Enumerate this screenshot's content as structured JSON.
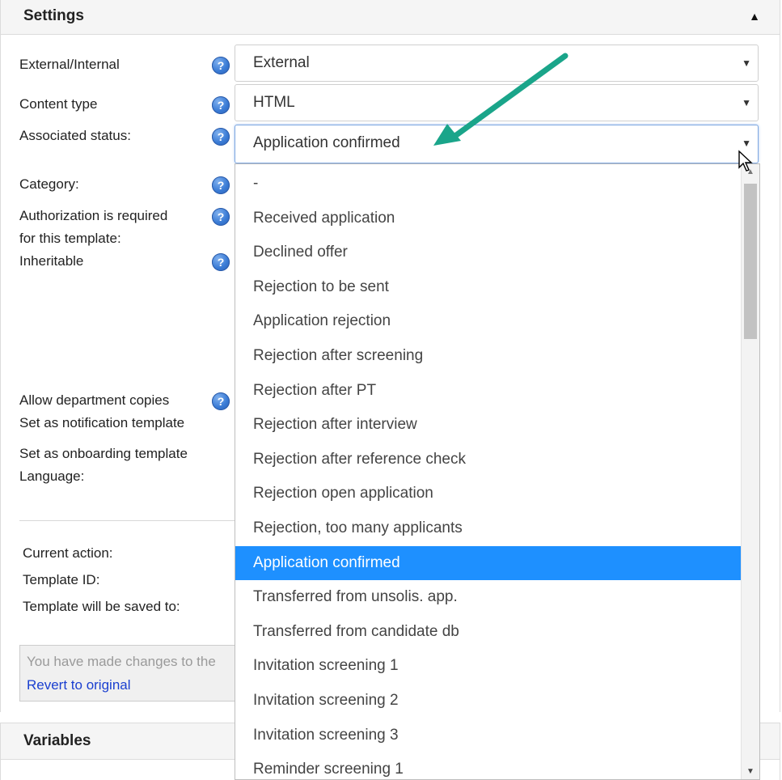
{
  "settings": {
    "title": "Settings",
    "collapse_icon": "caret-up-icon",
    "help_glyph": "?",
    "fields": {
      "external_internal": {
        "label": "External/Internal",
        "value": "External"
      },
      "content_type": {
        "label": "Content type",
        "value": "HTML"
      },
      "associated_status": {
        "label": "Associated status:",
        "value": "Application confirmed"
      },
      "category": {
        "label": "Category:"
      },
      "authorization": {
        "label_line1": "Authorization is required",
        "label_line2": "for this template:"
      },
      "inheritable": {
        "label": "Inheritable"
      },
      "allow_department_copies": {
        "label": "Allow department copies"
      },
      "notification_template": {
        "label": "Set as notification template"
      },
      "onboarding_template": {
        "label": "Set as onboarding template"
      },
      "language": {
        "label": "Language:"
      }
    },
    "info": {
      "current_action": "Current action:",
      "template_id": "Template ID:",
      "saved_to": "Template will be saved to:"
    },
    "notice": {
      "message": "You have made changes to the",
      "revert_link": "Revert to original"
    }
  },
  "status_dropdown": {
    "options": [
      "-",
      "Received application",
      "Declined offer",
      "Rejection to be sent",
      "Application rejection",
      "Rejection after screening",
      "Rejection after PT",
      "Rejection after interview",
      "Rejection after reference check",
      "Rejection open application",
      "Rejection, too many applicants",
      "Application confirmed",
      "Transferred from unsolis. app.",
      "Transferred from candidate db",
      "Invitation screening 1",
      "Invitation screening 2",
      "Invitation screening 3",
      "Reminder screening 1"
    ],
    "selected_index": 11,
    "highlight_color": "#1e90ff"
  },
  "variables": {
    "title": "Variables"
  },
  "annotation": {
    "arrow_color": "#1aa58a"
  }
}
